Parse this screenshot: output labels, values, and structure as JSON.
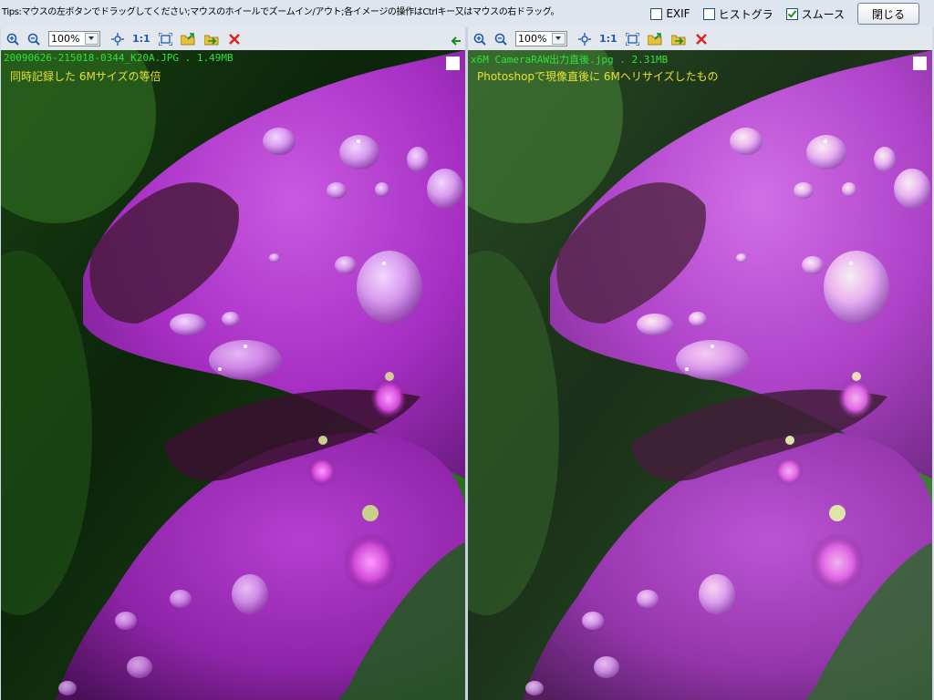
{
  "tips": "Tips:マウスの左ボタンでドラッグしてください;マウスのホイールでズームイン/アウト;各イメージの操作はCtrlキー又はマウスの右ドラッグ。",
  "options": {
    "exif": {
      "label": "EXIF",
      "checked": false
    },
    "histogram": {
      "label": "ヒストグラ",
      "checked": false
    },
    "smooth": {
      "label": "スムース",
      "checked": true
    }
  },
  "close_label": "閉じる",
  "panes": [
    {
      "zoom": "100%",
      "one_to_one": "1:1",
      "filename": "20090626-215018-0344_K20A.JPG . 1.49MB",
      "caption": "同時記録した 6Mサイズの等倍",
      "has_back_arrow": true
    },
    {
      "zoom": "100%",
      "one_to_one": "1:1",
      "filename": "x6M CameraRAW出力直後.jpg . 2.31MB",
      "caption": "Photoshopで現像直後に 6Mヘリサイズしたもの",
      "has_back_arrow": false
    }
  ],
  "colors": {
    "filename_text": "#2ee23a",
    "caption_text": "#e8e030",
    "close_icon": "#e02020",
    "zoom_icon": "#1f5aa8",
    "toolbar_bg": "#e3e7ee"
  },
  "icons": {
    "zoom_in": "zoom-in-icon",
    "zoom_out": "zoom-out-icon",
    "fit": "fit-window-icon",
    "fullscreen": "fullscreen-icon",
    "open": "open-folder-icon",
    "save": "next-file-icon",
    "close": "close-icon",
    "back": "back-arrow-icon"
  }
}
